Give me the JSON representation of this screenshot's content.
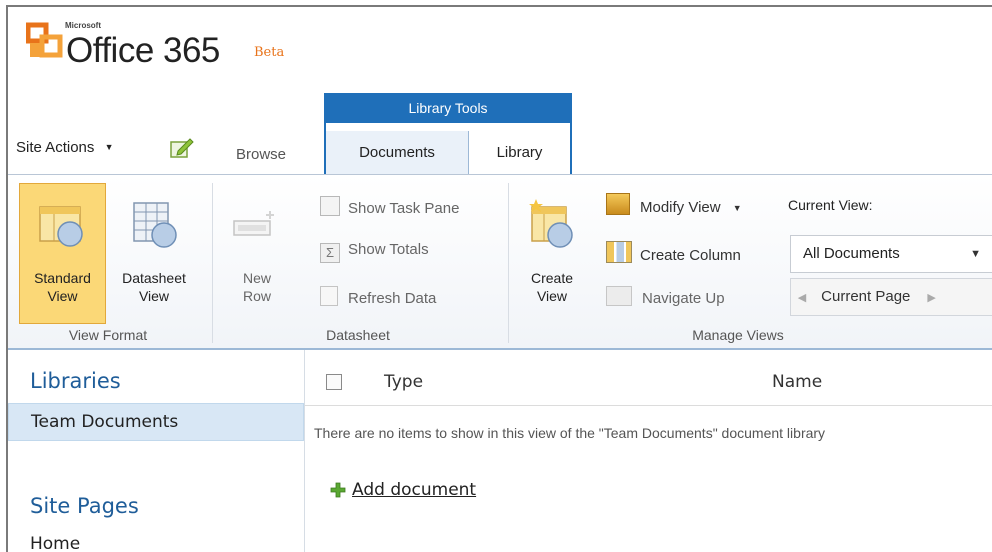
{
  "brand": {
    "ms": "Microsoft",
    "product": "Office 365",
    "badge": "Beta"
  },
  "topbar": {
    "site_actions": "Site Actions",
    "browse": "Browse"
  },
  "ribbon_tabs": {
    "group_label": "Library Tools",
    "documents": "Documents",
    "library": "Library"
  },
  "ribbon": {
    "view_format": {
      "label": "View Format",
      "standard": [
        "Standard",
        "View"
      ],
      "datasheet": [
        "Datasheet",
        "View"
      ]
    },
    "datasheet": {
      "label": "Datasheet",
      "new_row": [
        "New",
        "Row"
      ],
      "show_task_pane": "Show Task Pane",
      "show_totals": "Show Totals",
      "refresh_data": "Refresh Data"
    },
    "manage_views": {
      "label": "Manage Views",
      "create_view": [
        "Create",
        "View"
      ],
      "modify_view": "Modify View",
      "create_column": "Create Column",
      "navigate_up": "Navigate Up",
      "current_view_label": "Current View:",
      "current_view_value": "All Documents",
      "current_page": "Current Page"
    }
  },
  "nav": {
    "libraries_title": "Libraries",
    "libraries_items": [
      "Team Documents"
    ],
    "site_pages_title": "Site Pages",
    "site_pages_items": [
      "Home"
    ]
  },
  "list": {
    "columns": [
      "Type",
      "Name"
    ],
    "empty_message": "There are no items to show in this view of the \"Team Documents\" document library",
    "add_document": "Add document"
  },
  "colors": {
    "accent": "#1f6fb9",
    "selected": "#fbd877",
    "nav_title": "#1f5d99"
  }
}
